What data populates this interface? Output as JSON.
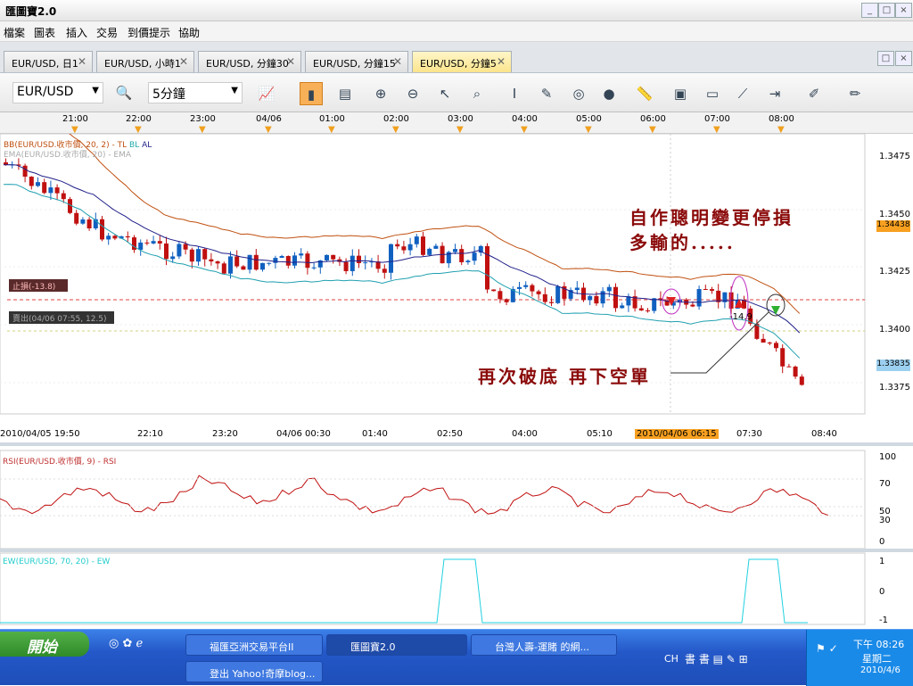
{
  "window": {
    "title": "匯圖寶2.0"
  },
  "menu": [
    "檔案",
    "圖表",
    "插入",
    "交易",
    "到價提示",
    "協助"
  ],
  "tabs": [
    {
      "label": "EUR/USD, 日1"
    },
    {
      "label": "EUR/USD, 小時1"
    },
    {
      "label": "EUR/USD, 分鐘30"
    },
    {
      "label": "EUR/USD, 分鐘15"
    },
    {
      "label": "EUR/USD, 分鐘5"
    }
  ],
  "toolbar": {
    "symbol": "EUR/USD",
    "timeframe": "5分鐘"
  },
  "top_time_labels": [
    "21:00",
    "22:00",
    "23:00",
    "04/06",
    "01:00",
    "02:00",
    "03:00",
    "04:00",
    "05:00",
    "06:00",
    "07:00",
    "08:00"
  ],
  "bottom_time_labels": [
    "2010/04/05 19:50",
    "22:10",
    "23:20",
    "04/06 00:30",
    "01:40",
    "02:50",
    "04:00",
    "05:10",
    "2010/04/06 06:15",
    "07:30",
    "08:40"
  ],
  "price_axis": [
    "1.3475",
    "1.3450",
    "1.3425",
    "1.3400",
    "1.3375"
  ],
  "price_badges": {
    "upper": "1.34438",
    "current": "1.33835"
  },
  "indicators": {
    "bb": "BB(EUR/USD.收市價, 20, 2) - TL",
    "bb_bl": "BL",
    "bb_al": "AL",
    "ema": "EMA(EUR/USD.收市價, 20) - EMA",
    "rsi": "RSI(EUR/USD.收市價, 9) - RSI",
    "ew": "EW(EUR/USD, 70, 20) - EW"
  },
  "order_labels": {
    "stop": "止損(-13.8)",
    "sell": "賣出(04/06 07:55, 12.5)",
    "marker": "-14.9"
  },
  "rsi_axis": [
    "100",
    "70",
    "50",
    "30",
    "0"
  ],
  "ew_axis": [
    "1",
    "0",
    "-1"
  ],
  "annotations": {
    "line1": "自作聰明變更停損",
    "line2": "多輸的.....",
    "line3": "再次破底  再下空單"
  },
  "taskbar": {
    "start": "開始",
    "tasks": [
      "福匯亞洲交易平台II",
      "匯圖寶2.0",
      "台灣人壽-運賭 的網...",
      "登出 Yahoo!奇摩blog..."
    ],
    "lang": "CH",
    "time": "下午 08:26",
    "weekday": "星期二",
    "date": "2010/4/6"
  },
  "chart_data": {
    "type": "candlestick",
    "symbol": "EUR/USD",
    "timeframe": "5分鐘",
    "ylim": [
      1.3365,
      1.3485
    ]
  }
}
